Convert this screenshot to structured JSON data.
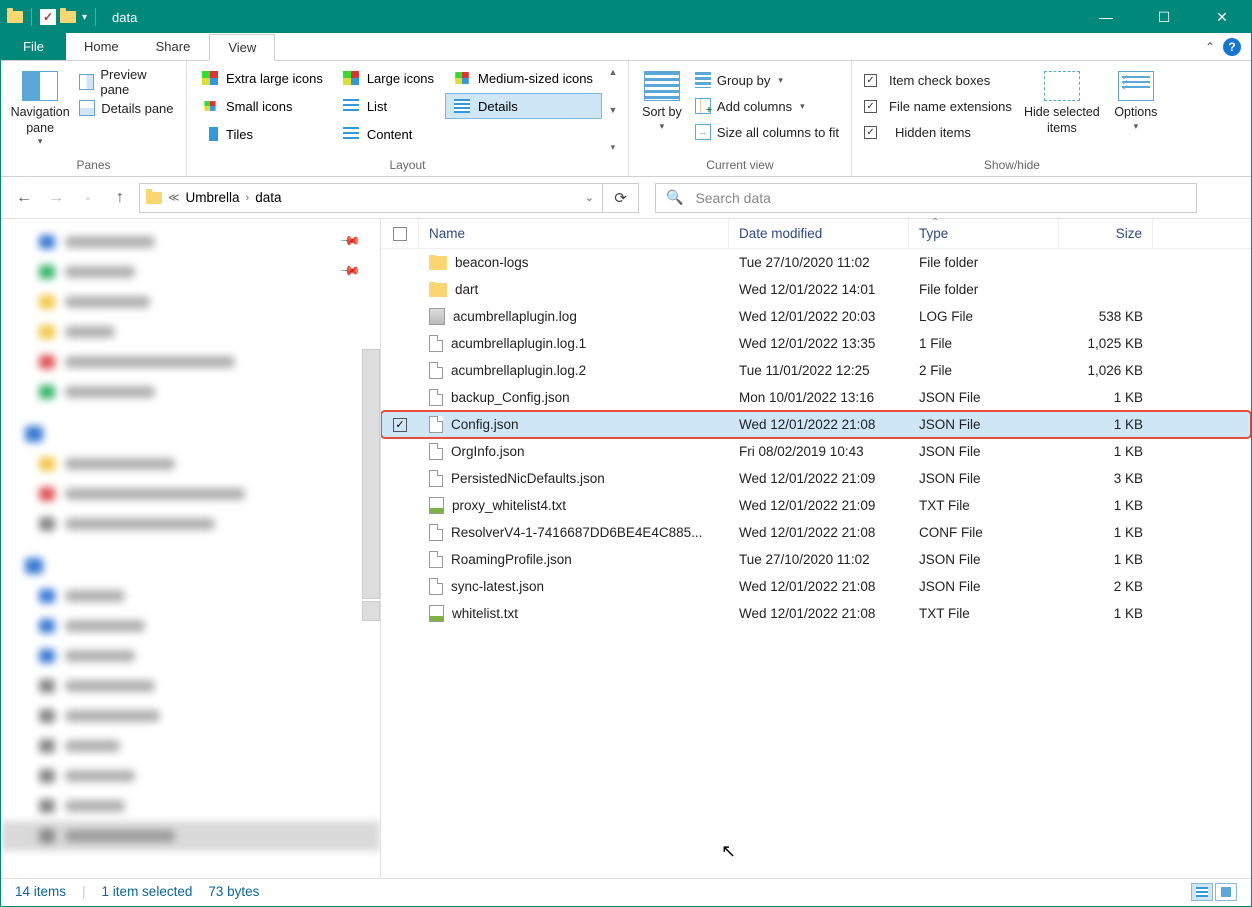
{
  "window": {
    "title": "data"
  },
  "tabs": {
    "file": "File",
    "home": "Home",
    "share": "Share",
    "view": "View"
  },
  "ribbon": {
    "panes": {
      "label": "Panes",
      "navigation": "Navigation pane",
      "preview": "Preview pane",
      "details": "Details pane"
    },
    "layout": {
      "label": "Layout",
      "xl": "Extra large icons",
      "lg": "Large icons",
      "med": "Medium-sized icons",
      "sm": "Small icons",
      "list": "List",
      "details": "Details",
      "tiles": "Tiles",
      "content": "Content"
    },
    "current_view": {
      "label": "Current view",
      "sort": "Sort by",
      "group": "Group by",
      "add_cols": "Add columns",
      "size_cols": "Size all columns to fit"
    },
    "showhide": {
      "label": "Show/hide",
      "item_chk": "Item check boxes",
      "ext": "File name extensions",
      "hidden": "Hidden items",
      "hide_sel": "Hide selected items",
      "options": "Options"
    }
  },
  "breadcrumb": {
    "seg1": "Umbrella",
    "seg2": "data"
  },
  "search": {
    "placeholder": "Search data"
  },
  "columns": {
    "name": "Name",
    "date": "Date modified",
    "type": "Type",
    "size": "Size"
  },
  "files": [
    {
      "icon": "folder",
      "name": "beacon-logs",
      "date": "Tue 27/10/2020 11:02",
      "type": "File folder",
      "size": ""
    },
    {
      "icon": "folder",
      "name": "dart",
      "date": "Wed 12/01/2022 14:01",
      "type": "File folder",
      "size": ""
    },
    {
      "icon": "log",
      "name": "acumbrellaplugin.log",
      "date": "Wed 12/01/2022 20:03",
      "type": "LOG File",
      "size": "538 KB"
    },
    {
      "icon": "file",
      "name": "acumbrellaplugin.log.1",
      "date": "Wed 12/01/2022 13:35",
      "type": "1 File",
      "size": "1,025 KB"
    },
    {
      "icon": "file",
      "name": "acumbrellaplugin.log.2",
      "date": "Tue 11/01/2022 12:25",
      "type": "2 File",
      "size": "1,026 KB"
    },
    {
      "icon": "file",
      "name": "backup_Config.json",
      "date": "Mon 10/01/2022 13:16",
      "type": "JSON File",
      "size": "1 KB"
    },
    {
      "icon": "file",
      "name": "Config.json",
      "date": "Wed 12/01/2022 21:08",
      "type": "JSON File",
      "size": "1 KB",
      "selected": true,
      "checked": true,
      "highlight": true
    },
    {
      "icon": "file",
      "name": "OrgInfo.json",
      "date": "Fri 08/02/2019 10:43",
      "type": "JSON File",
      "size": "1 KB"
    },
    {
      "icon": "file",
      "name": "PersistedNicDefaults.json",
      "date": "Wed 12/01/2022 21:09",
      "type": "JSON File",
      "size": "3 KB"
    },
    {
      "icon": "txt",
      "name": "proxy_whitelist4.txt",
      "date": "Wed 12/01/2022 21:09",
      "type": "TXT File",
      "size": "1 KB"
    },
    {
      "icon": "file",
      "name": "ResolverV4-1-7416687DD6BE4E4C885...",
      "date": "Wed 12/01/2022 21:08",
      "type": "CONF File",
      "size": "1 KB"
    },
    {
      "icon": "file",
      "name": "RoamingProfile.json",
      "date": "Tue 27/10/2020 11:02",
      "type": "JSON File",
      "size": "1 KB"
    },
    {
      "icon": "file",
      "name": "sync-latest.json",
      "date": "Wed 12/01/2022 21:08",
      "type": "JSON File",
      "size": "2 KB"
    },
    {
      "icon": "txt",
      "name": "whitelist.txt",
      "date": "Wed 12/01/2022 21:08",
      "type": "TXT File",
      "size": "1 KB"
    }
  ],
  "status": {
    "count": "14 items",
    "selected": "1 item selected",
    "bytes": "73 bytes"
  }
}
